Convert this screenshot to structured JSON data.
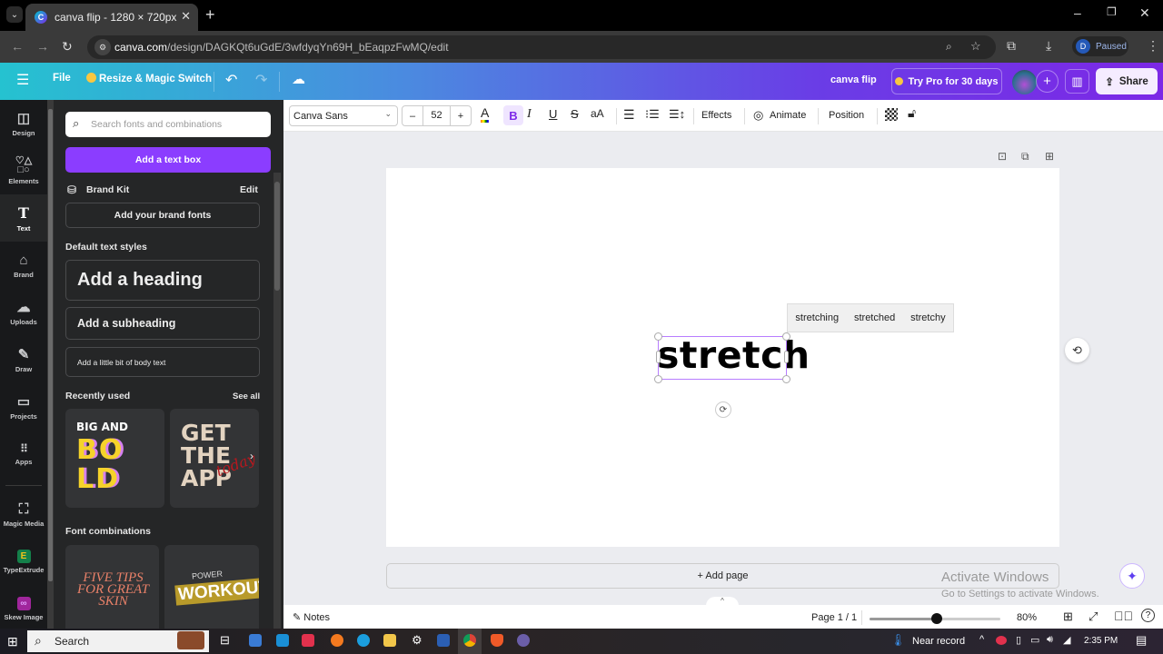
{
  "browser": {
    "tab_title": "canva flip - 1280 × 720px",
    "favicon": "C",
    "url_domain": "canva.com",
    "url_path": "/design/DAGKQt6uGdE/3wfdyqYn69H_bEaqpzFwMQ/edit",
    "profile_initial": "D",
    "profile_status": "Paused"
  },
  "header": {
    "menu_label": "File",
    "resize_label": "Resize & Magic Switch",
    "doc_title": "canva flip",
    "try_pro_label": "Try Pro for 30 days",
    "share_label": "Share"
  },
  "rail": {
    "items": [
      {
        "label": "Design",
        "icon": "layout-icon"
      },
      {
        "label": "Elements",
        "icon": "shapes-icon"
      },
      {
        "label": "Text",
        "icon": "text-icon"
      },
      {
        "label": "Brand",
        "icon": "brand-icon"
      },
      {
        "label": "Uploads",
        "icon": "upload-cloud-icon"
      },
      {
        "label": "Draw",
        "icon": "draw-icon"
      },
      {
        "label": "Projects",
        "icon": "folder-icon"
      },
      {
        "label": "Apps",
        "icon": "apps-grid-icon"
      },
      {
        "label": "Magic Media",
        "icon": "magic-media-icon"
      },
      {
        "label": "TypeExtrude",
        "icon": "typeextrude-icon"
      },
      {
        "label": "Skew Image",
        "icon": "skew-image-icon"
      }
    ],
    "active": "Text"
  },
  "panel": {
    "search_placeholder": "Search fonts and combinations",
    "add_textbox_label": "Add a text box",
    "brand_kit_label": "Brand Kit",
    "brand_kit_edit": "Edit",
    "add_brand_fonts": "Add your brand fonts",
    "default_styles_title": "Default text styles",
    "heading": "Add a heading",
    "subheading": "Add a subheading",
    "body": "Add a little bit of body text",
    "recent_title": "Recently used",
    "see_all": "See all",
    "recent_thumbs": [
      {
        "line1": "BIG AND",
        "line2": "BO",
        "line3": "LD"
      },
      {
        "line1": "GET",
        "line2": "THE",
        "line3": "APP",
        "script": "today"
      }
    ],
    "font_combos_title": "Font combinations",
    "font_combos": [
      {
        "text": "FIVE TIPS FOR GREAT SKIN"
      },
      {
        "top": "POWER",
        "main": "WORKOUT"
      }
    ]
  },
  "toolbar": {
    "font": "Canva Sans",
    "size_minus": "–",
    "size": "52",
    "size_plus": "+",
    "text_color": "A",
    "bold": "B",
    "italic": "I",
    "underline": "U",
    "strike": "S",
    "case": "aA",
    "effects": "Effects",
    "animate": "Animate",
    "position": "Position"
  },
  "canvas": {
    "text": "stretch",
    "suggestions": [
      "stretching",
      "stretched",
      "stretchy"
    ],
    "add_page": "+ Add page",
    "watermark_title": "Activate Windows",
    "watermark_sub": "Go to Settings to activate Windows."
  },
  "footer": {
    "notes": "Notes",
    "page_indicator": "Page 1 / 1",
    "zoom_percent": 80,
    "zoom_label": "80%"
  },
  "taskbar": {
    "search": "Search",
    "weather": "Near record",
    "time": "2:35 PM"
  },
  "colors": {
    "accent": "#8b3dff",
    "selection": "#b77dff"
  }
}
